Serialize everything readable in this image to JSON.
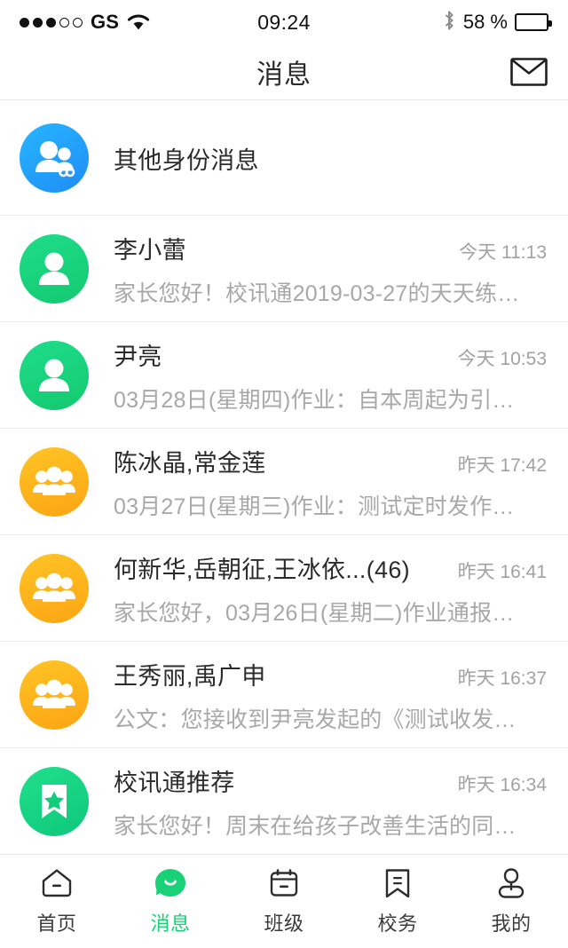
{
  "status_bar": {
    "signal_dots_filled": 3,
    "signal_dots_total": 5,
    "carrier": "GS",
    "wifi_icon": "wifi-icon",
    "time": "09:24",
    "bluetooth_icon": "bluetooth-icon",
    "battery_percent": "58 %",
    "battery_level": 58
  },
  "header": {
    "title": "消息",
    "action_icon": "envelope-icon"
  },
  "conversations": [
    {
      "name": "其他身份消息",
      "time": "",
      "preview": "",
      "avatar_icon": "two-people-infinity-icon",
      "avatar_style": "av-blue"
    },
    {
      "name": "李小蕾",
      "time": "今天 11:13",
      "preview": "家长您好！校讯通2019-03-27的天天练…",
      "avatar_icon": "person-icon",
      "avatar_style": "av-green"
    },
    {
      "name": "尹亮",
      "time": "今天 10:53",
      "preview": "03月28日(星期四)作业：自本周起为引…",
      "avatar_icon": "person-icon",
      "avatar_style": "av-green"
    },
    {
      "name": "陈冰晶,常金莲",
      "time": "昨天 17:42",
      "preview": "03月27日(星期三)作业：测试定时发作…",
      "avatar_icon": "group-icon",
      "avatar_style": "av-orange"
    },
    {
      "name": "何新华,岳朝征,王冰依...(46)",
      "time": "昨天 16:41",
      "preview": "家长您好，03月26日(星期二)作业通报…",
      "avatar_icon": "group-icon",
      "avatar_style": "av-orange"
    },
    {
      "name": "王秀丽,禹广申",
      "time": "昨天 16:37",
      "preview": "公文：您接收到尹亮发起的《测试收发…",
      "avatar_icon": "group-icon",
      "avatar_style": "av-orange"
    },
    {
      "name": "校讯通推荐",
      "time": "昨天 16:34",
      "preview": "家长您好！周末在给孩子改善生活的同…",
      "avatar_icon": "bookmark-star-icon",
      "avatar_style": "av-green2"
    }
  ],
  "tabs": [
    {
      "label": "首页",
      "icon": "home-icon",
      "active": false
    },
    {
      "label": "消息",
      "icon": "message-bubble-icon",
      "active": true
    },
    {
      "label": "班级",
      "icon": "calendar-icon",
      "active": false
    },
    {
      "label": "校务",
      "icon": "bookmark-lines-icon",
      "active": false
    },
    {
      "label": "我的",
      "icon": "person-icon",
      "active": false
    }
  ],
  "colors": {
    "accent_green": "#18cf72",
    "avatar_blue": "#1f9bf8",
    "avatar_orange": "#fcb017",
    "text_primary": "#2b2b2b",
    "text_secondary": "#a8a8a8",
    "divider": "#ededed"
  }
}
